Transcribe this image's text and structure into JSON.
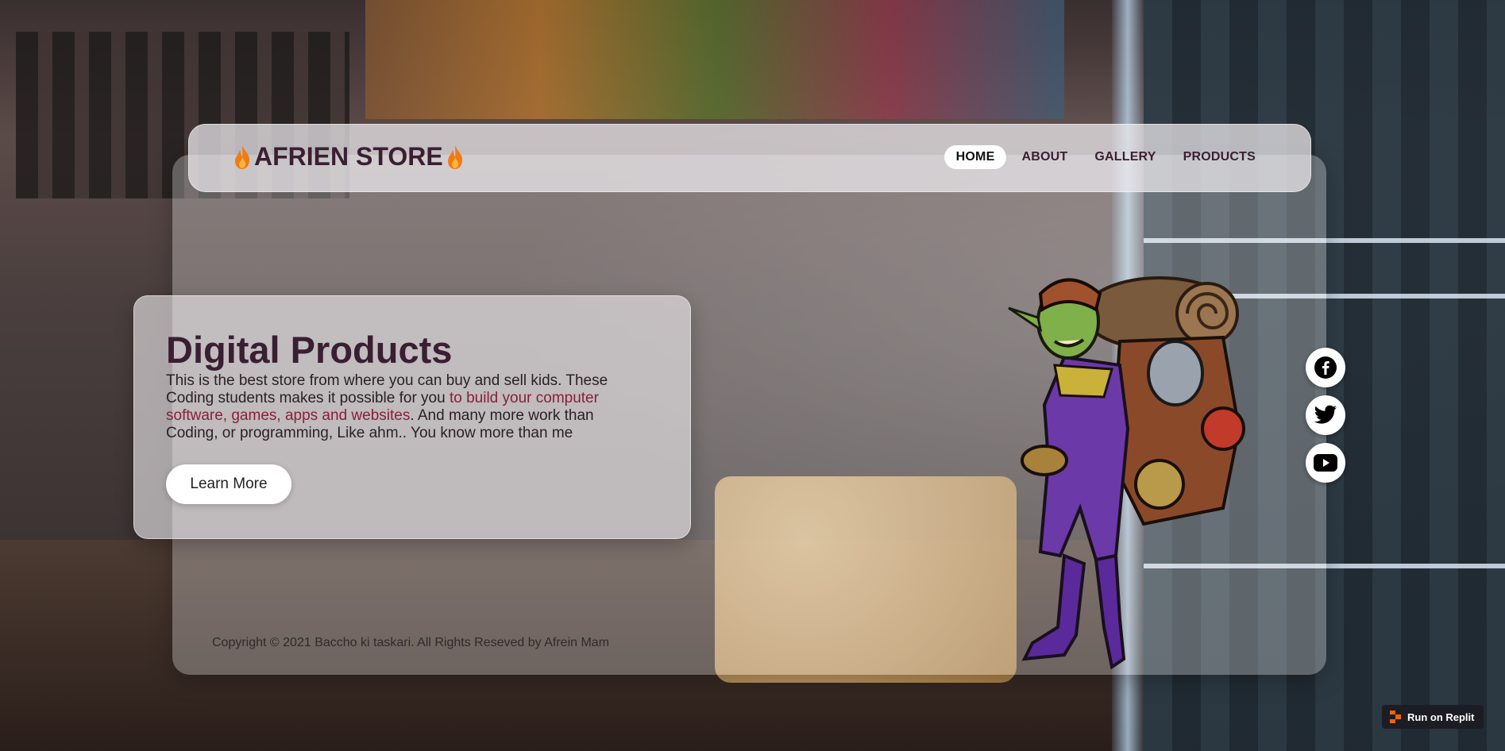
{
  "brand": {
    "name": "AFRIEN STORE"
  },
  "nav": {
    "items": [
      {
        "label": "HOME",
        "active": true
      },
      {
        "label": "ABOUT",
        "active": false
      },
      {
        "label": "GALLERY",
        "active": false
      },
      {
        "label": "PRODUCTS",
        "active": false
      }
    ]
  },
  "hero": {
    "title": "Digital Products",
    "text_before": "This is the best store from where you can buy and sell kids. These Coding students makes it possible for you ",
    "text_highlight": "to build your computer software, games, apps and websites",
    "text_after": ". And many more work than Coding, or programming, Like ahm.. You know more than me",
    "button": "Learn More"
  },
  "footer": {
    "copyright": "Copyright © 2021 Baccho ki taskari. All Rights Reseved by Afrein Mam"
  },
  "social": [
    "facebook-icon",
    "twitter-icon",
    "youtube-icon"
  ],
  "replit": {
    "label": "Run on Replit"
  },
  "colors": {
    "brand": "#3a1f33",
    "highlight": "#8a1f3a",
    "accent_flame": "#f07b14"
  }
}
